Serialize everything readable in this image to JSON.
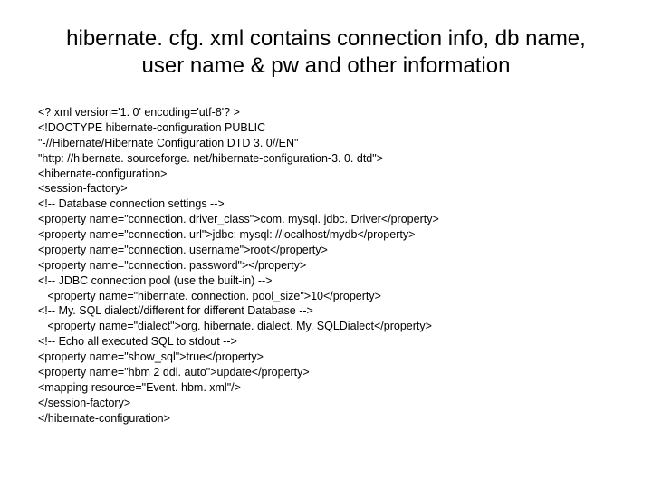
{
  "title": "hibernate. cfg. xml contains connection info, db name, user name & pw and other information",
  "lines": [
    "<? xml version='1. 0' encoding='utf-8'? >",
    "<!DOCTYPE hibernate-configuration PUBLIC",
    "\"-//Hibernate/Hibernate Configuration DTD 3. 0//EN\"",
    "\"http: //hibernate. sourceforge. net/hibernate-configuration-3. 0. dtd\">",
    "<hibernate-configuration>",
    "<session-factory>",
    "<!-- Database connection settings -->",
    "<property name=\"connection. driver_class\">com. mysql. jdbc. Driver</property>",
    "<property name=\"connection. url\">jdbc: mysql: //localhost/mydb</property>",
    "<property name=\"connection. username\">root</property>",
    "<property name=\"connection. password\"></property>",
    "<!-- JDBC connection pool (use the built-in) -->",
    "   <property name=\"hibernate. connection. pool_size\">10</property>",
    "<!-- My. SQL dialect//different for different Database -->",
    "   <property name=\"dialect\">org. hibernate. dialect. My. SQLDialect</property>",
    "<!-- Echo all executed SQL to stdout -->",
    "<property name=\"show_sql\">true</property>",
    "<property name=\"hbm 2 ddl. auto\">update</property>",
    "<mapping resource=\"Event. hbm. xml\"/>",
    "</session-factory>",
    "</hibernate-configuration>"
  ]
}
